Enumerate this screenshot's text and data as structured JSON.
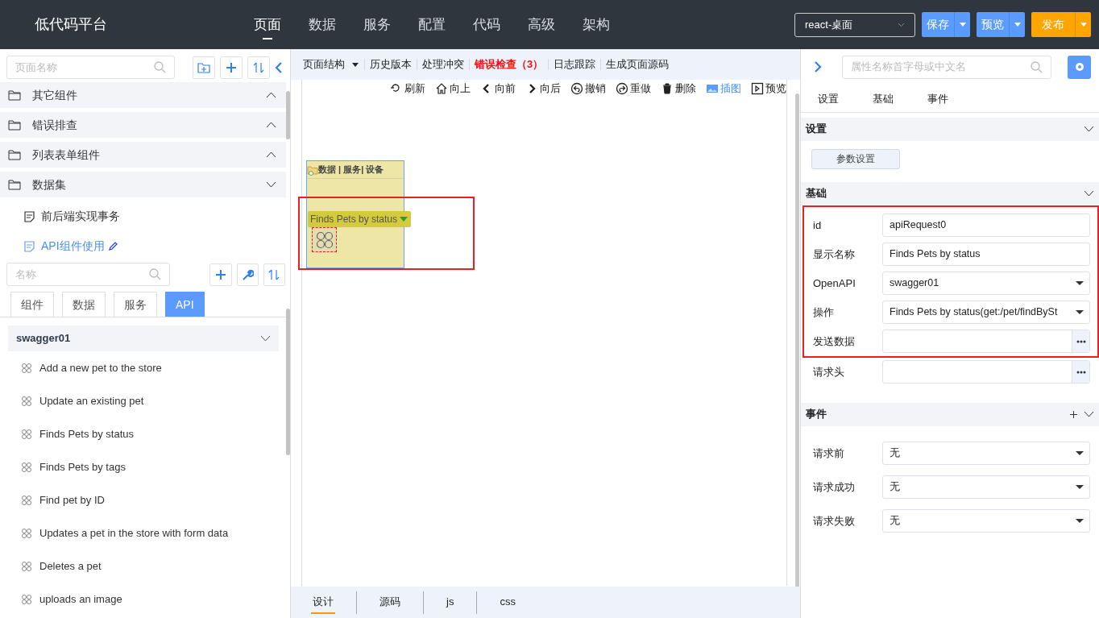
{
  "app_title": "低代码平台",
  "main_nav": [
    {
      "label": "页面",
      "selected": true
    },
    {
      "label": "数据",
      "selected": false
    },
    {
      "label": "服务",
      "selected": false
    },
    {
      "label": "配置",
      "selected": false
    },
    {
      "label": "代码",
      "selected": false
    },
    {
      "label": "高级",
      "selected": false
    },
    {
      "label": "架构",
      "selected": false
    }
  ],
  "framework_select": {
    "value": "react-桌面"
  },
  "header_buttons": [
    {
      "label": "保存",
      "kind": "primary"
    },
    {
      "label": "预览",
      "kind": "primary"
    },
    {
      "label": "发布",
      "kind": "warning"
    }
  ],
  "left_panel": {
    "page_search": {
      "placeholder": "页面名称"
    },
    "folders": [
      {
        "label": "其它组件",
        "expanded": false
      },
      {
        "label": "错误排查",
        "expanded": false
      },
      {
        "label": "列表表单组件",
        "expanded": false
      },
      {
        "label": "数据集",
        "expanded": true
      }
    ],
    "pages": [
      {
        "label": "前后端实现事务",
        "selected": false
      },
      {
        "label": "API组件使用",
        "selected": true
      }
    ],
    "component_search": {
      "placeholder": "名称"
    },
    "tabs": [
      {
        "label": "组件",
        "selected": false
      },
      {
        "label": "数据",
        "selected": false
      },
      {
        "label": "服务",
        "selected": false
      },
      {
        "label": "API",
        "selected": true
      }
    ],
    "api_group": {
      "label": "swagger01",
      "expanded": true
    },
    "operations": [
      "Add a new pet to the store",
      "Update an existing pet",
      "Finds Pets by status",
      "Finds Pets by tags",
      "Find pet by ID",
      "Updates a pet in the store with form data",
      "Deletes a pet",
      "uploads an image"
    ]
  },
  "center": {
    "menu": [
      {
        "label": "页面结构",
        "kind": "dropdown"
      },
      {
        "label": "历史版本",
        "kind": "plain"
      },
      {
        "label": "处理冲突",
        "kind": "plain"
      },
      {
        "label": "错误检查（3）",
        "kind": "error"
      },
      {
        "label": "日志跟踪",
        "kind": "plain"
      },
      {
        "label": "生成页面源码",
        "kind": "plain"
      }
    ],
    "actions": [
      {
        "label": "刷新",
        "active": false
      },
      {
        "label": "向上",
        "active": false
      },
      {
        "label": "向前",
        "active": false
      },
      {
        "label": "向后",
        "active": false
      },
      {
        "label": "撤销",
        "active": false
      },
      {
        "label": "重做",
        "active": false
      },
      {
        "label": "删除",
        "active": false
      },
      {
        "label": "插图",
        "active": true
      },
      {
        "label": "预览",
        "active": false
      }
    ],
    "canvas": {
      "container_title": "数据 | 服务| 设备",
      "component_label": "Finds Pets by status",
      "highlighted": true
    },
    "bottom_tabs": [
      {
        "label": "设计",
        "selected": true
      },
      {
        "label": "源码",
        "selected": false
      },
      {
        "label": "js",
        "selected": false
      },
      {
        "label": "css",
        "selected": false
      }
    ]
  },
  "right_panel": {
    "search": {
      "placeholder": "属性名称首字母或中文名"
    },
    "tabs": [
      "设置",
      "基础",
      "事件"
    ],
    "settings": {
      "title": "设置",
      "expanded": true,
      "button": "参数设置"
    },
    "basics": {
      "title": "基础",
      "expanded": true,
      "fields": [
        {
          "label": "id",
          "kind": "text",
          "value": "apiRequest0",
          "highlighted": true
        },
        {
          "label": "显示名称",
          "kind": "text",
          "value": "Finds Pets by status",
          "highlighted": true
        },
        {
          "label": "OpenAPI",
          "kind": "select",
          "value": "swagger01",
          "highlighted": true
        },
        {
          "label": "操作",
          "kind": "select",
          "value": "Finds Pets by status(get:/pet/findBySt",
          "highlighted": true
        },
        {
          "label": "发送数据",
          "kind": "dialog",
          "highlighted": true
        },
        {
          "label": "请求头",
          "kind": "dialog",
          "highlighted": false
        }
      ]
    },
    "events": {
      "title": "事件",
      "expanded": true,
      "fields": [
        {
          "label": "请求前",
          "kind": "select",
          "value": "无"
        },
        {
          "label": "请求成功",
          "kind": "select",
          "value": "无"
        },
        {
          "label": "请求失败",
          "kind": "select",
          "value": "无"
        }
      ]
    }
  }
}
